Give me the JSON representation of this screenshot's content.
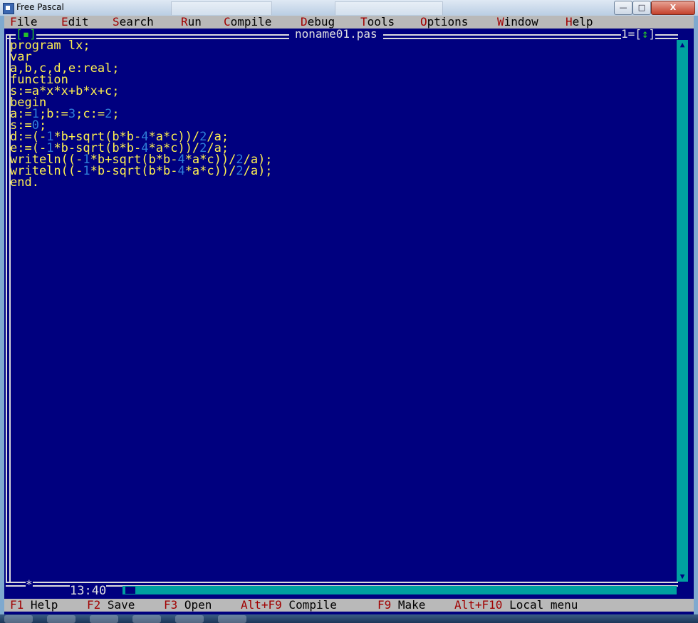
{
  "window": {
    "title": "Free Pascal",
    "controls": {
      "minimize": "—",
      "maximize": "□",
      "close": "X"
    }
  },
  "menu": [
    {
      "hotkey": "F",
      "rest": "ile"
    },
    {
      "hotkey": "E",
      "rest": "dit"
    },
    {
      "hotkey": "S",
      "rest": "earch"
    },
    {
      "hotkey": "R",
      "rest": "un"
    },
    {
      "hotkey": "C",
      "rest": "ompile"
    },
    {
      "hotkey": "D",
      "rest": "ebug"
    },
    {
      "hotkey": "T",
      "rest": "ools"
    },
    {
      "hotkey": "O",
      "rest": "ptions"
    },
    {
      "hotkey": "W",
      "rest": "indow"
    },
    {
      "hotkey": "H",
      "rest": "elp"
    }
  ],
  "editor": {
    "close_box": "[▪]",
    "file_name": "noname01.pas",
    "window_number": "1=[",
    "window_zoom": "↕",
    "window_number_close": "]",
    "modified_marker": "*",
    "cursor_position": "13:40",
    "code_lines": [
      "program lx;",
      "var",
      "a,b,c,d,e:real;",
      "function",
      "s:=a*x*x+b*x+c;",
      "begin",
      "a:=1;b:=3;c:=2;",
      "s:=0;",
      "d:=(-1*b+sqrt(b*b-4*a*c))/2/a;",
      "e:=(-1*b-sqrt(b*b-4*a*c))/2/a;",
      "writeln((-1*b+sqrt(b*b-4*a*c))/2/a);",
      "writeln((-1*b-sqrt(b*b-4*a*c))/2/a);",
      "end."
    ]
  },
  "status_bar": [
    {
      "key": "F1",
      "label": " Help"
    },
    {
      "key": "F2",
      "label": " Save"
    },
    {
      "key": "F3",
      "label": " Open"
    },
    {
      "key": "Alt+F9",
      "label": " Compile"
    },
    {
      "key": "F9",
      "label": " Make"
    },
    {
      "key": "Alt+F10",
      "label": " Local menu"
    }
  ],
  "colors": {
    "editor_bg": "#00007f",
    "code_text": "#fff14f",
    "numbers": "#2f7fd8",
    "menu_bg": "#b9b9b9",
    "hotkey": "#a00000",
    "scrollbar": "#00a0a0"
  }
}
